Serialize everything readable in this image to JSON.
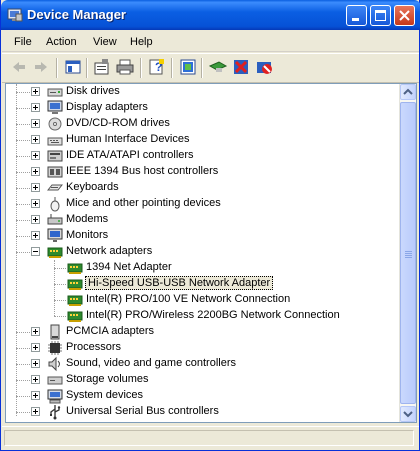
{
  "window": {
    "title": "Device Manager"
  },
  "menu": [
    {
      "label": "File"
    },
    {
      "label": "Action"
    },
    {
      "label": "View"
    },
    {
      "label": "Help"
    }
  ],
  "toolbar": {
    "buttons": [
      "back-icon",
      "forward-icon",
      "show-hide-tree-icon",
      "properties-icon",
      "print-icon",
      "help-icon",
      "update-driver-icon",
      "scan-hardware-icon",
      "disable-device-icon",
      "uninstall-device-icon"
    ]
  },
  "tree": {
    "items": [
      {
        "label": "Disk drives",
        "icon": "disk-drive-icon",
        "expanded": false
      },
      {
        "label": "Display adapters",
        "icon": "display-adapter-icon",
        "expanded": false
      },
      {
        "label": "DVD/CD-ROM drives",
        "icon": "cdrom-icon",
        "expanded": false
      },
      {
        "label": "Human Interface Devices",
        "icon": "hid-icon",
        "expanded": false
      },
      {
        "label": "IDE ATA/ATAPI controllers",
        "icon": "ide-controller-icon",
        "expanded": false
      },
      {
        "label": "IEEE 1394 Bus host controllers",
        "icon": "ieee1394-icon",
        "expanded": false
      },
      {
        "label": "Keyboards",
        "icon": "keyboard-icon",
        "expanded": false
      },
      {
        "label": "Mice and other pointing devices",
        "icon": "mouse-icon",
        "expanded": false
      },
      {
        "label": "Modems",
        "icon": "modem-icon",
        "expanded": false
      },
      {
        "label": "Monitors",
        "icon": "monitor-icon",
        "expanded": false
      },
      {
        "label": "Network adapters",
        "icon": "network-adapter-icon",
        "expanded": true,
        "children": [
          {
            "label": "1394 Net Adapter"
          },
          {
            "label": "Hi-Speed USB-USB Network Adapter",
            "selected": true
          },
          {
            "label": "Intel(R) PRO/100 VE Network Connection"
          },
          {
            "label": "Intel(R) PRO/Wireless 2200BG Network Connection"
          }
        ]
      },
      {
        "label": "PCMCIA adapters",
        "icon": "pcmcia-icon",
        "expanded": false
      },
      {
        "label": "Processors",
        "icon": "processor-icon",
        "expanded": false
      },
      {
        "label": "Sound, video and game controllers",
        "icon": "sound-icon",
        "expanded": false
      },
      {
        "label": "Storage volumes",
        "icon": "storage-volume-icon",
        "expanded": false
      },
      {
        "label": "System devices",
        "icon": "system-device-icon",
        "expanded": false
      },
      {
        "label": "Universal Serial Bus controllers",
        "icon": "usb-icon",
        "expanded": false
      }
    ]
  },
  "colors": {
    "titlebar": "#0b5fe3",
    "selection": "#ece9d8",
    "window_bg": "#ece9d8"
  }
}
